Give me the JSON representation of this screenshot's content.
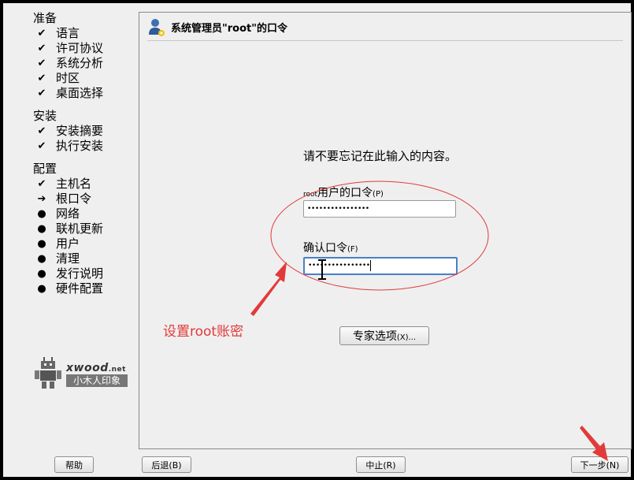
{
  "sidebar": {
    "sections": [
      {
        "title": "准备",
        "steps": [
          {
            "label": "语言",
            "mark": "✔"
          },
          {
            "label": "许可协议",
            "mark": "✔"
          },
          {
            "label": "系统分析",
            "mark": "✔"
          },
          {
            "label": "时区",
            "mark": "✔"
          },
          {
            "label": "桌面选择",
            "mark": "✔"
          }
        ]
      },
      {
        "title": "安装",
        "steps": [
          {
            "label": "安装摘要",
            "mark": "✔"
          },
          {
            "label": "执行安装",
            "mark": "✔"
          }
        ]
      },
      {
        "title": "配置",
        "steps": [
          {
            "label": "主机名",
            "mark": "✔"
          },
          {
            "label": "根口令",
            "mark": "➔"
          },
          {
            "label": "网络",
            "mark": "●"
          },
          {
            "label": "联机更新",
            "mark": "●"
          },
          {
            "label": "用户",
            "mark": "●"
          },
          {
            "label": "清理",
            "mark": "●"
          },
          {
            "label": "发行说明",
            "mark": "●"
          },
          {
            "label": "硬件配置",
            "mark": "●"
          }
        ]
      }
    ]
  },
  "watermark": {
    "brand": "xwood",
    "brand_suffix": ".net",
    "tagline": "小木人印象"
  },
  "panel": {
    "title": "系统管理员\"root\"的口令",
    "intro": "请不要忘记在此输入的内容。",
    "password_label_prefix": "root",
    "password_label": "用户的口令",
    "password_mnemonic": "(P)",
    "password_value": "••••••••••••••••",
    "confirm_label": "确认口令",
    "confirm_mnemonic": "(F)",
    "confirm_value": "••••••••••••••••",
    "expert_button": "专家选项",
    "expert_mnemonic": "(X)..."
  },
  "annotation": {
    "text": "设置root账密",
    "color": "#e23a3a"
  },
  "footer": {
    "help": "帮助",
    "back": "后退(B)",
    "abort": "中止(R)",
    "next": "下一步(N)"
  },
  "colors": {
    "background": "#efefef",
    "focus_border": "#4a7fc7",
    "annotation": "#e23a3a"
  }
}
